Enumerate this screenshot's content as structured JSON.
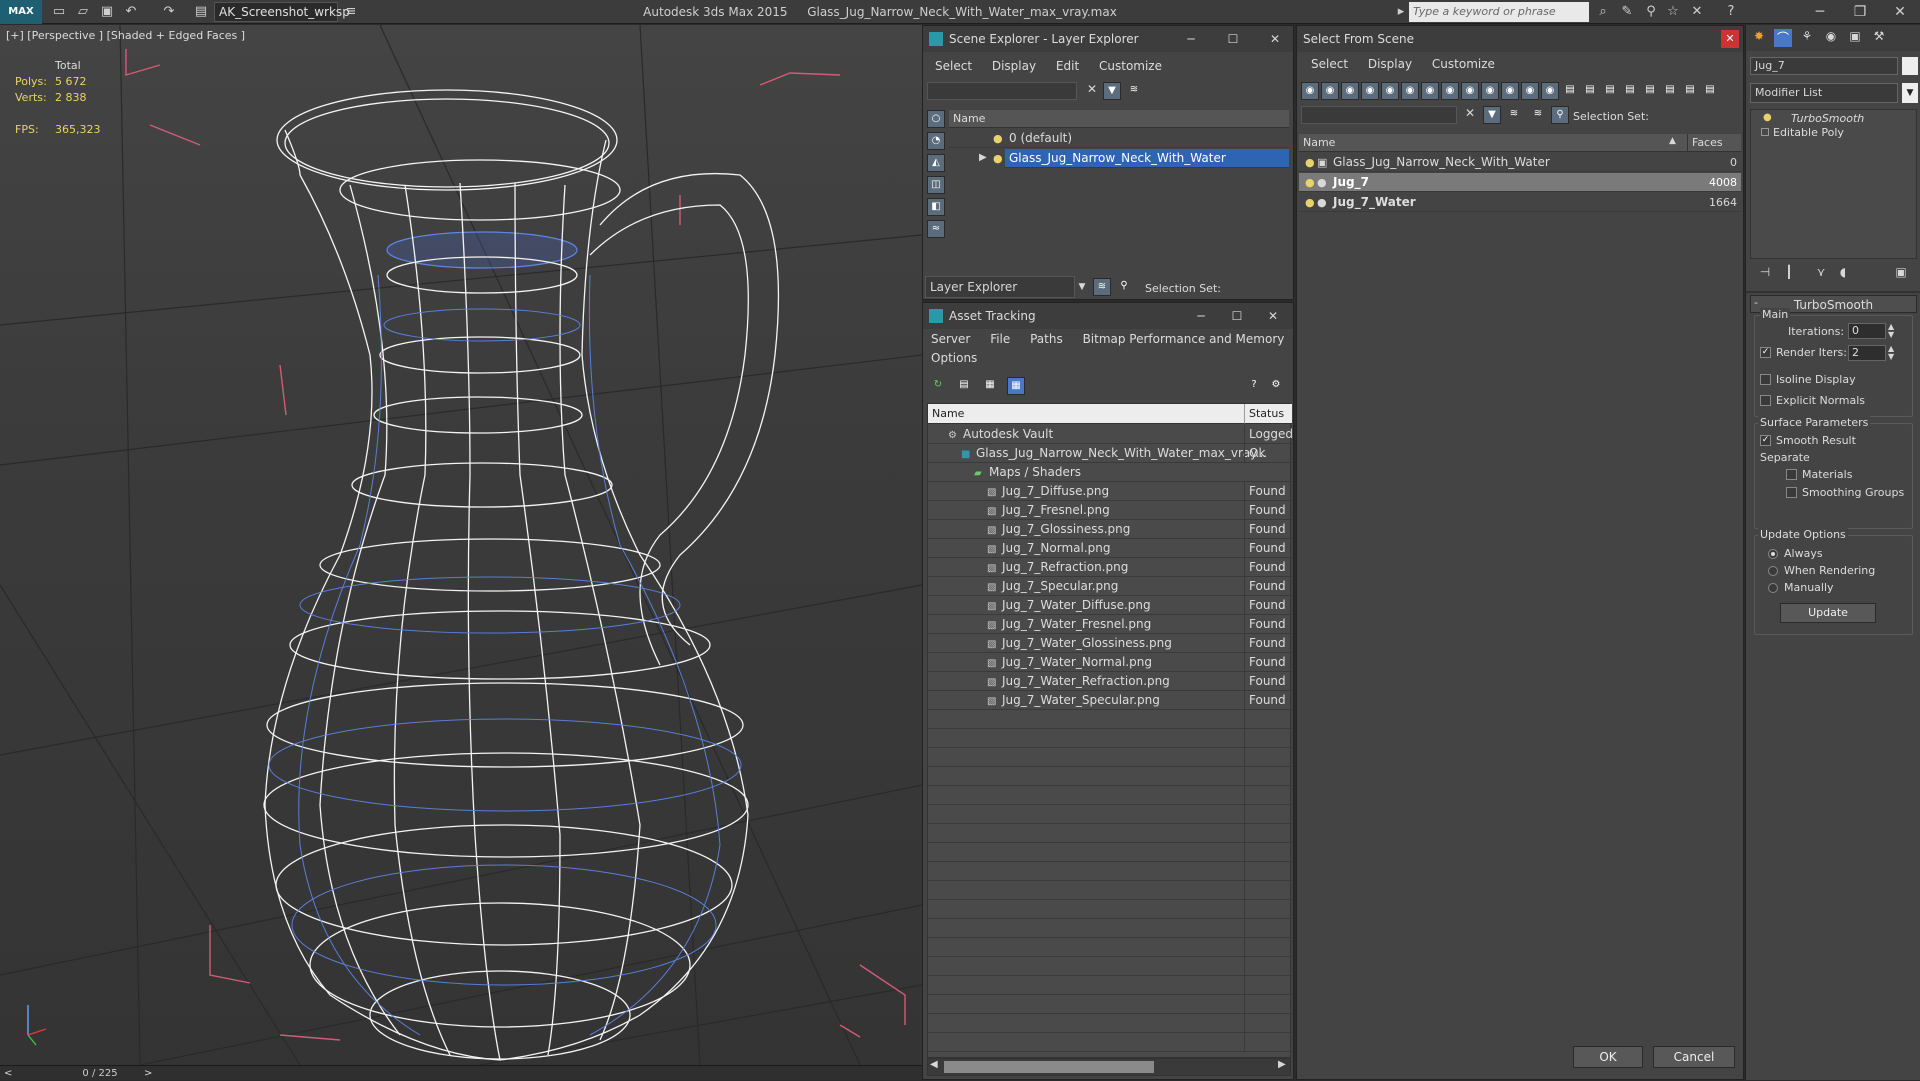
{
  "titlebar": {
    "logo": "MAX",
    "workspace": "AK_Screenshot_wrksp",
    "app_name": "Autodesk 3ds Max  2015",
    "file_name": "Glass_Jug_Narrow_Neck_With_Water_max_vray.max",
    "search_placeholder": "Type a keyword or phrase"
  },
  "viewport": {
    "label": "[+] [Perspective ] [Shaded + Edged Faces ]",
    "stats": {
      "total_label": "Total",
      "polys_label": "Polys:",
      "polys_value": "5 672",
      "verts_label": "Verts:",
      "verts_value": "2 838",
      "fps_label": "FPS:",
      "fps_value": "365,323"
    }
  },
  "timeline": {
    "frame": "0 / 225",
    "prev": "<",
    "next": ">"
  },
  "scene_explorer": {
    "title": "Scene Explorer - Layer Explorer",
    "menu": [
      "Select",
      "Display",
      "Edit",
      "Customize"
    ],
    "column_name": "Name",
    "rows": [
      "0 (default)",
      "Glass_Jug_Narrow_Neck_With_Water"
    ],
    "footer_dropdown": "Layer Explorer",
    "selection_set_label": "Selection Set:"
  },
  "asset_tracking": {
    "title": "Asset Tracking",
    "menu": [
      "Server",
      "File",
      "Paths",
      "Bitmap Performance and Memory"
    ],
    "menu2": [
      "Options"
    ],
    "col_name": "Name",
    "col_status": "Status",
    "rows": [
      {
        "name": "Autodesk Vault",
        "status": "Logged",
        "indent": 0
      },
      {
        "name": "Glass_Jug_Narrow_Neck_With_Water_max_vray...",
        "status": "Ok",
        "indent": 1
      },
      {
        "name": "Maps / Shaders",
        "status": "",
        "indent": 2
      },
      {
        "name": "Jug_7_Diffuse.png",
        "status": "Found",
        "indent": 3
      },
      {
        "name": "Jug_7_Fresnel.png",
        "status": "Found",
        "indent": 3
      },
      {
        "name": "Jug_7_Glossiness.png",
        "status": "Found",
        "indent": 3
      },
      {
        "name": "Jug_7_Normal.png",
        "status": "Found",
        "indent": 3
      },
      {
        "name": "Jug_7_Refraction.png",
        "status": "Found",
        "indent": 3
      },
      {
        "name": "Jug_7_Specular.png",
        "status": "Found",
        "indent": 3
      },
      {
        "name": "Jug_7_Water_Diffuse.png",
        "status": "Found",
        "indent": 3
      },
      {
        "name": "Jug_7_Water_Fresnel.png",
        "status": "Found",
        "indent": 3
      },
      {
        "name": "Jug_7_Water_Glossiness.png",
        "status": "Found",
        "indent": 3
      },
      {
        "name": "Jug_7_Water_Normal.png",
        "status": "Found",
        "indent": 3
      },
      {
        "name": "Jug_7_Water_Refraction.png",
        "status": "Found",
        "indent": 3
      },
      {
        "name": "Jug_7_Water_Specular.png",
        "status": "Found",
        "indent": 3
      }
    ]
  },
  "select_from_scene": {
    "title": "Select From Scene",
    "menu": [
      "Select",
      "Display",
      "Customize"
    ],
    "selection_set_label": "Selection Set:",
    "col_name": "Name",
    "col_faces": "Faces",
    "rows": [
      {
        "name": "Glass_Jug_Narrow_Neck_With_Water",
        "faces": "0"
      },
      {
        "name": "Jug_7",
        "faces": "4008"
      },
      {
        "name": "Jug_7_Water",
        "faces": "1664"
      }
    ],
    "ok_label": "OK",
    "cancel_label": "Cancel"
  },
  "command_panel": {
    "object_name": "Jug_7",
    "modifier_list": "Modifier List",
    "stack": [
      "TurboSmooth",
      "Editable Poly"
    ],
    "turbosmooth": {
      "title": "TurboSmooth",
      "main_label": "Main",
      "iterations_label": "Iterations:",
      "iterations_value": "0",
      "render_iters_label": "Render Iters:",
      "render_iters_value": "2",
      "isoline_label": "Isoline Display",
      "explicit_normals_label": "Explicit Normals",
      "surface_params_label": "Surface Parameters",
      "smooth_result_label": "Smooth Result",
      "separate_label": "Separate",
      "materials_label": "Materials",
      "smoothing_groups_label": "Smoothing Groups",
      "update_options_label": "Update Options",
      "always_label": "Always",
      "when_rendering_label": "When Rendering",
      "manually_label": "Manually",
      "update_label": "Update"
    }
  },
  "colors": {
    "selection_blue": "#2f64b4",
    "wire_white": "#ffffff",
    "water_blue": "#4a6fd0",
    "stat_yellow": "#e8d36a"
  }
}
